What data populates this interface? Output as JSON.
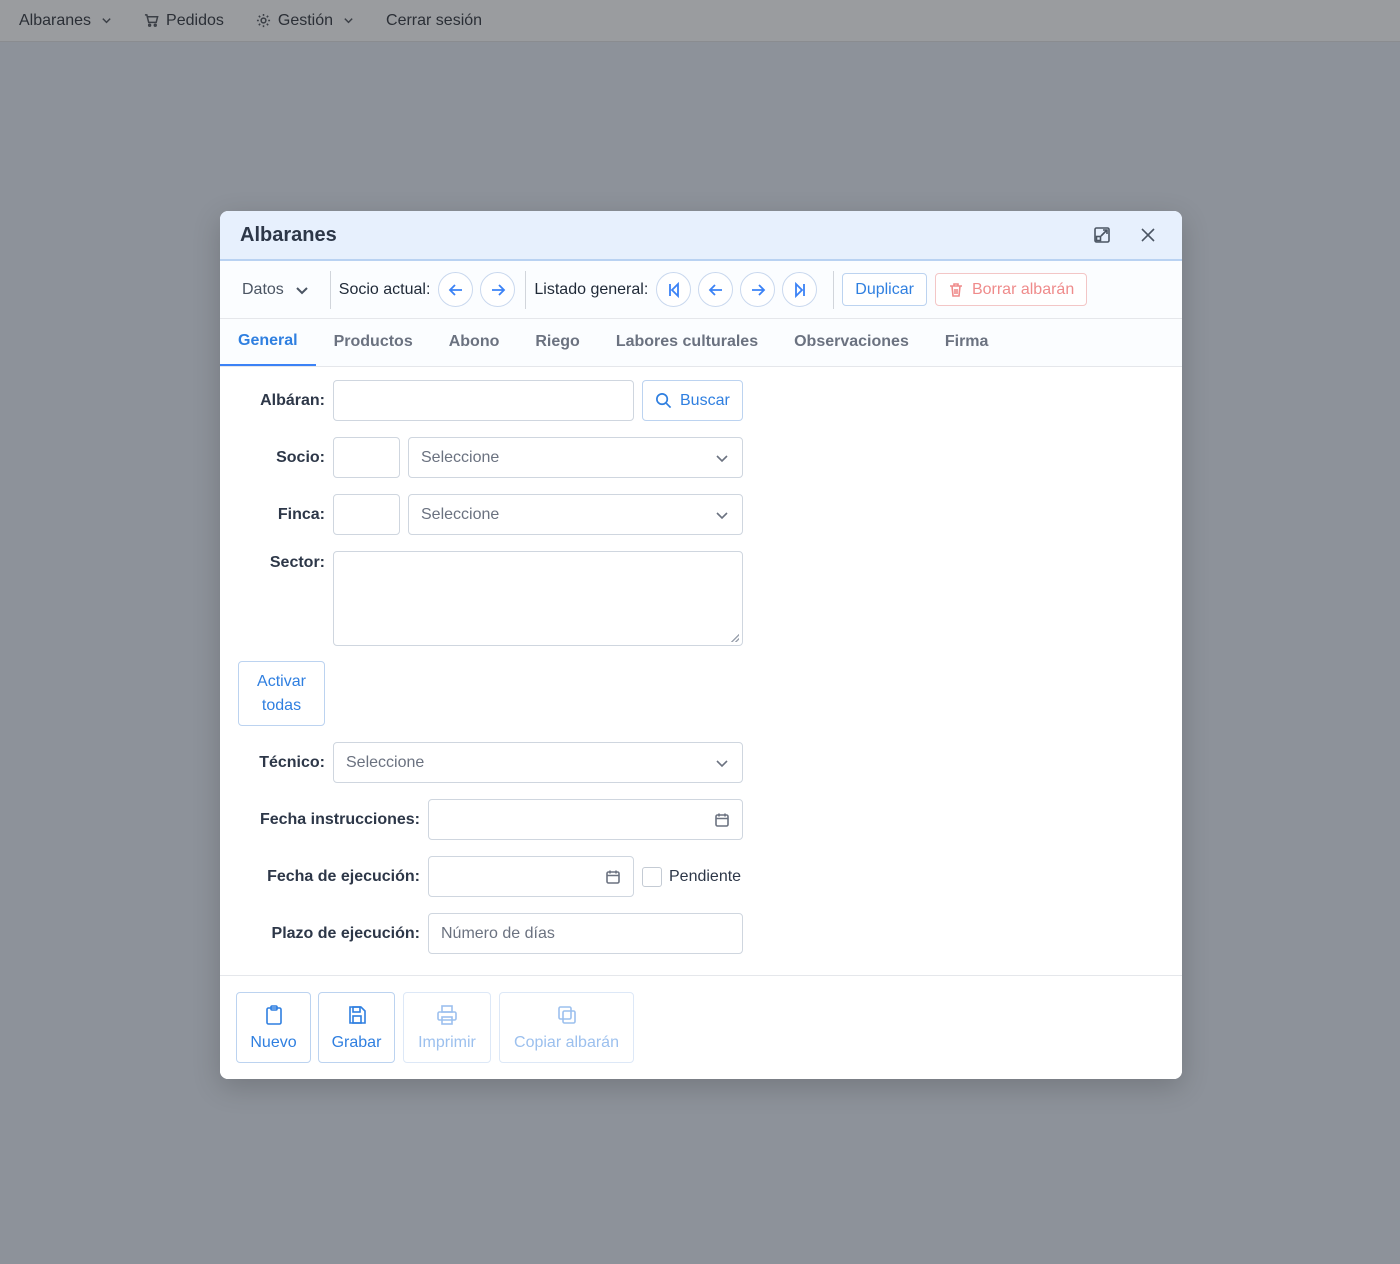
{
  "nav": {
    "albaranes": "Albaranes",
    "pedidos": "Pedidos",
    "gestion": "Gestión",
    "cerrar_sesion": "Cerrar sesión"
  },
  "modal": {
    "title": "Albaranes"
  },
  "toolbar": {
    "datos": "Datos",
    "socio_actual": "Socio actual:",
    "listado_general": "Listado general:",
    "duplicar": "Duplicar",
    "borrar": "Borrar albarán"
  },
  "tabs": [
    {
      "label": "General",
      "active": true
    },
    {
      "label": "Productos"
    },
    {
      "label": "Abono"
    },
    {
      "label": "Riego"
    },
    {
      "label": "Labores culturales"
    },
    {
      "label": "Observaciones"
    },
    {
      "label": "Firma"
    }
  ],
  "form": {
    "albaran_label": "Albáran:",
    "albaran_value": "",
    "buscar": "Buscar",
    "socio_label": "Socio:",
    "socio_code": "",
    "socio_select": "Seleccione",
    "finca_label": "Finca:",
    "finca_code": "",
    "finca_select": "Seleccione",
    "sector_label": "Sector:",
    "activar_line1": "Activar",
    "activar_line2": "todas",
    "tecnico_label": "Técnico:",
    "tecnico_select": "Seleccione",
    "fecha_instrucciones_label": "Fecha instrucciones:",
    "fecha_ejecucion_label": "Fecha de ejecución:",
    "pendiente": "Pendiente",
    "plazo_label": "Plazo de ejecución:",
    "plazo_placeholder": "Número de días"
  },
  "footer": {
    "nuevo": "Nuevo",
    "grabar": "Grabar",
    "imprimir": "Imprimir",
    "copiar": "Copiar albarán"
  },
  "colors": {
    "accent": "#2f7fe0",
    "header_bg": "#e7f0fd",
    "danger": "#ef8b8b",
    "overlay": "#8d929a"
  }
}
